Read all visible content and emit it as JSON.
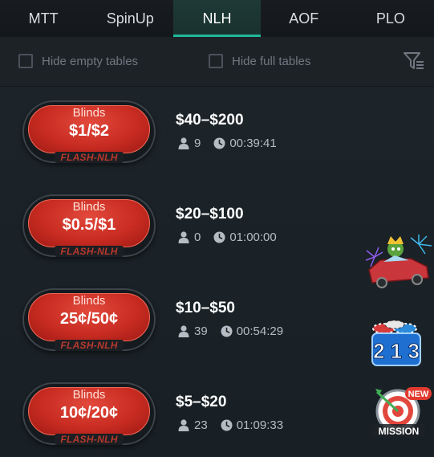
{
  "tabs": [
    {
      "label": "MTT"
    },
    {
      "label": "SpinUp"
    },
    {
      "label": "NLH",
      "active": true
    },
    {
      "label": "AOF"
    },
    {
      "label": "PLO"
    }
  ],
  "filters": {
    "hide_empty": {
      "label": "Hide empty tables",
      "checked": false
    },
    "hide_full": {
      "label": "Hide full tables",
      "checked": false
    }
  },
  "tables": [
    {
      "blinds_label": "Blinds",
      "stakes": "$1/$2",
      "game": "FLASH-NLH",
      "buyin": "$40–$200",
      "players": "9",
      "time": "00:39:41"
    },
    {
      "blinds_label": "Blinds",
      "stakes": "$0.5/$1",
      "game": "FLASH-NLH",
      "buyin": "$20–$100",
      "players": "0",
      "time": "01:00:00"
    },
    {
      "blinds_label": "Blinds",
      "stakes": "25¢/50¢",
      "game": "FLASH-NLH",
      "buyin": "$10–$50",
      "players": "39",
      "time": "00:54:29"
    },
    {
      "blinds_label": "Blinds",
      "stakes": "10¢/20¢",
      "game": "FLASH-NLH",
      "buyin": "$5–$20",
      "players": "23",
      "time": "01:09:33"
    }
  ],
  "promos": {
    "spin_numbers": "2 1 3",
    "mission_label": "MISSION",
    "mission_badge": "NEW"
  },
  "colors": {
    "accent": "#1fb89a",
    "pill_red": "#c92c22",
    "background": "#1b2228"
  }
}
